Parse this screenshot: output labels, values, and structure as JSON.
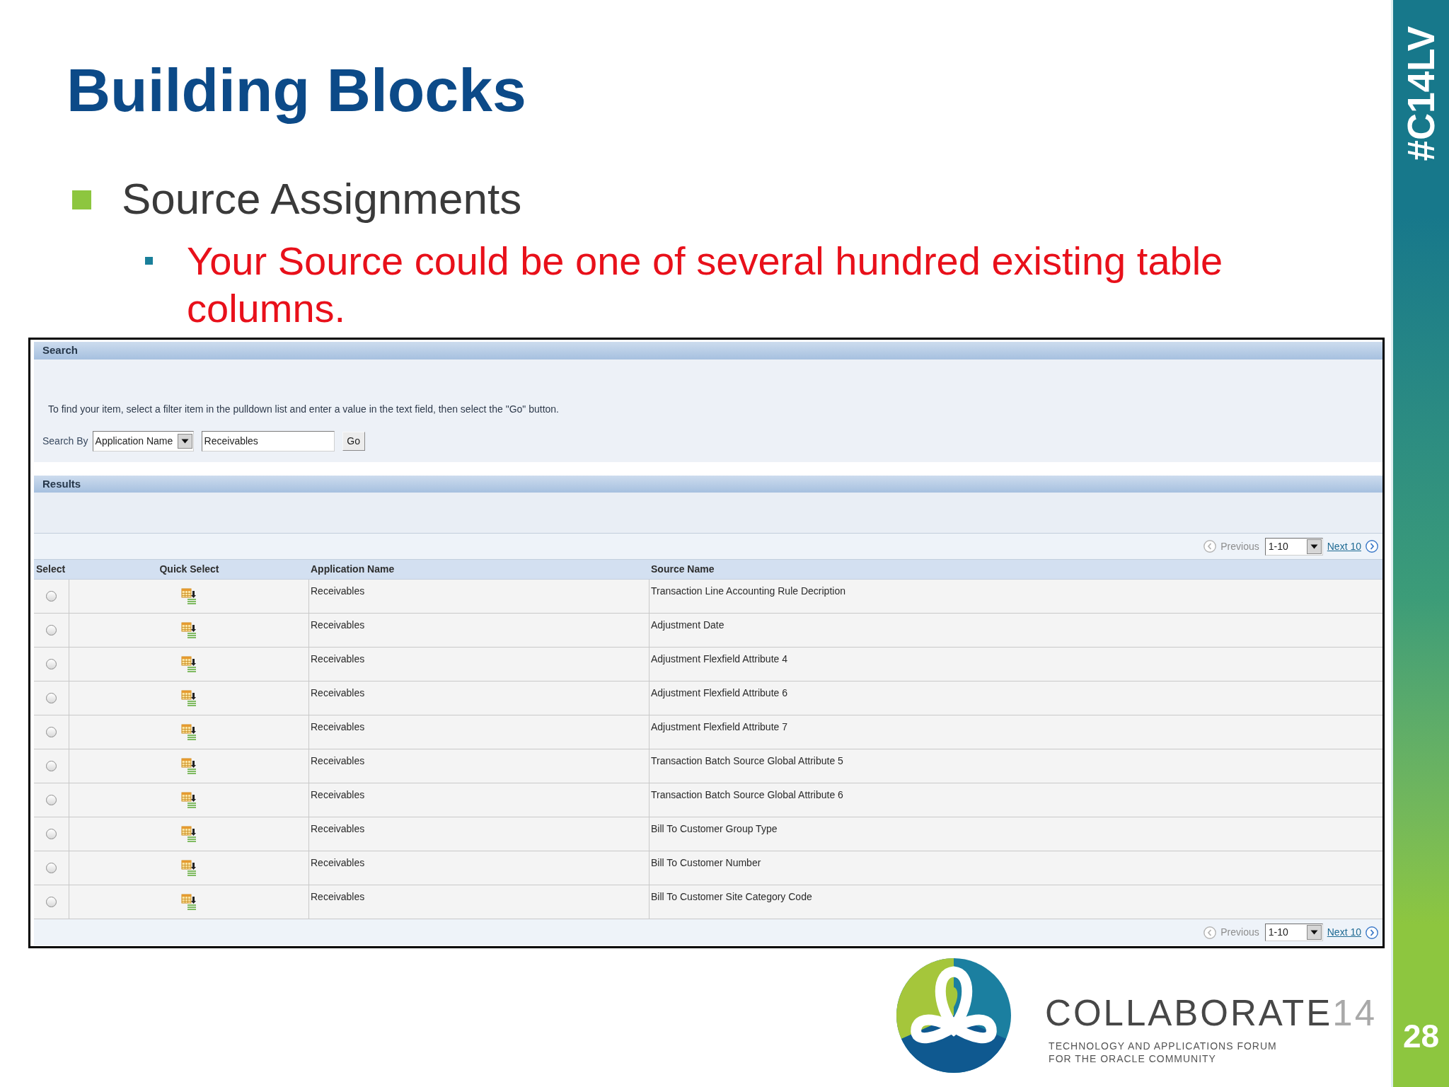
{
  "slide": {
    "title": "Building Blocks",
    "bullets": [
      {
        "text": "Source Assignments",
        "children": [
          {
            "text": "Your Source could be one of several hundred existing table columns."
          }
        ]
      }
    ]
  },
  "screenshot": {
    "search": {
      "header": "Search",
      "instructions": "To find your item, select a filter item in the pulldown list and enter a value in the text field, then select the \"Go\" button.",
      "search_by_label": "Search By",
      "filter_select": "Application Name",
      "text_field": "Receivables",
      "go_button": "Go"
    },
    "results": {
      "header": "Results",
      "pagination_top": {
        "previous": {
          "label": "Previous",
          "disabled": true
        },
        "range": "1-10",
        "next": {
          "label": "Next 10",
          "disabled": false
        }
      },
      "table": {
        "columns": [
          "Select",
          "Quick Select",
          "Application Name",
          "Source Name"
        ],
        "rows": [
          {
            "selected": false,
            "application_name": "Receivables",
            "source_name": "Transaction Line Accounting Rule Decription"
          },
          {
            "selected": false,
            "application_name": "Receivables",
            "source_name": "Adjustment Date"
          },
          {
            "selected": false,
            "application_name": "Receivables",
            "source_name": "Adjustment Flexfield Attribute 4"
          },
          {
            "selected": false,
            "application_name": "Receivables",
            "source_name": "Adjustment Flexfield Attribute 6"
          },
          {
            "selected": false,
            "application_name": "Receivables",
            "source_name": "Adjustment Flexfield Attribute 7"
          },
          {
            "selected": false,
            "application_name": "Receivables",
            "source_name": "Transaction Batch Source Global Attribute 5"
          },
          {
            "selected": false,
            "application_name": "Receivables",
            "source_name": "Transaction Batch Source Global Attribute 6"
          },
          {
            "selected": false,
            "application_name": "Receivables",
            "source_name": "Bill To Customer Group Type"
          },
          {
            "selected": false,
            "application_name": "Receivables",
            "source_name": "Bill To Customer Number"
          },
          {
            "selected": false,
            "application_name": "Receivables",
            "source_name": "Bill To Customer Site Category Code"
          }
        ]
      },
      "pagination_bottom": {
        "previous": {
          "label": "Previous",
          "disabled": true
        },
        "range": "1-10",
        "next": {
          "label": "Next 10",
          "disabled": false
        }
      }
    }
  },
  "branding": {
    "hashtag": "#C14LV",
    "page_number": "28",
    "logo": {
      "name": "COLLABORATE",
      "edition": "14",
      "tagline": [
        "TECHNOLOGY AND APPLICATIONS FORUM",
        "FOR THE ORACLE COMMUNITY"
      ]
    }
  }
}
